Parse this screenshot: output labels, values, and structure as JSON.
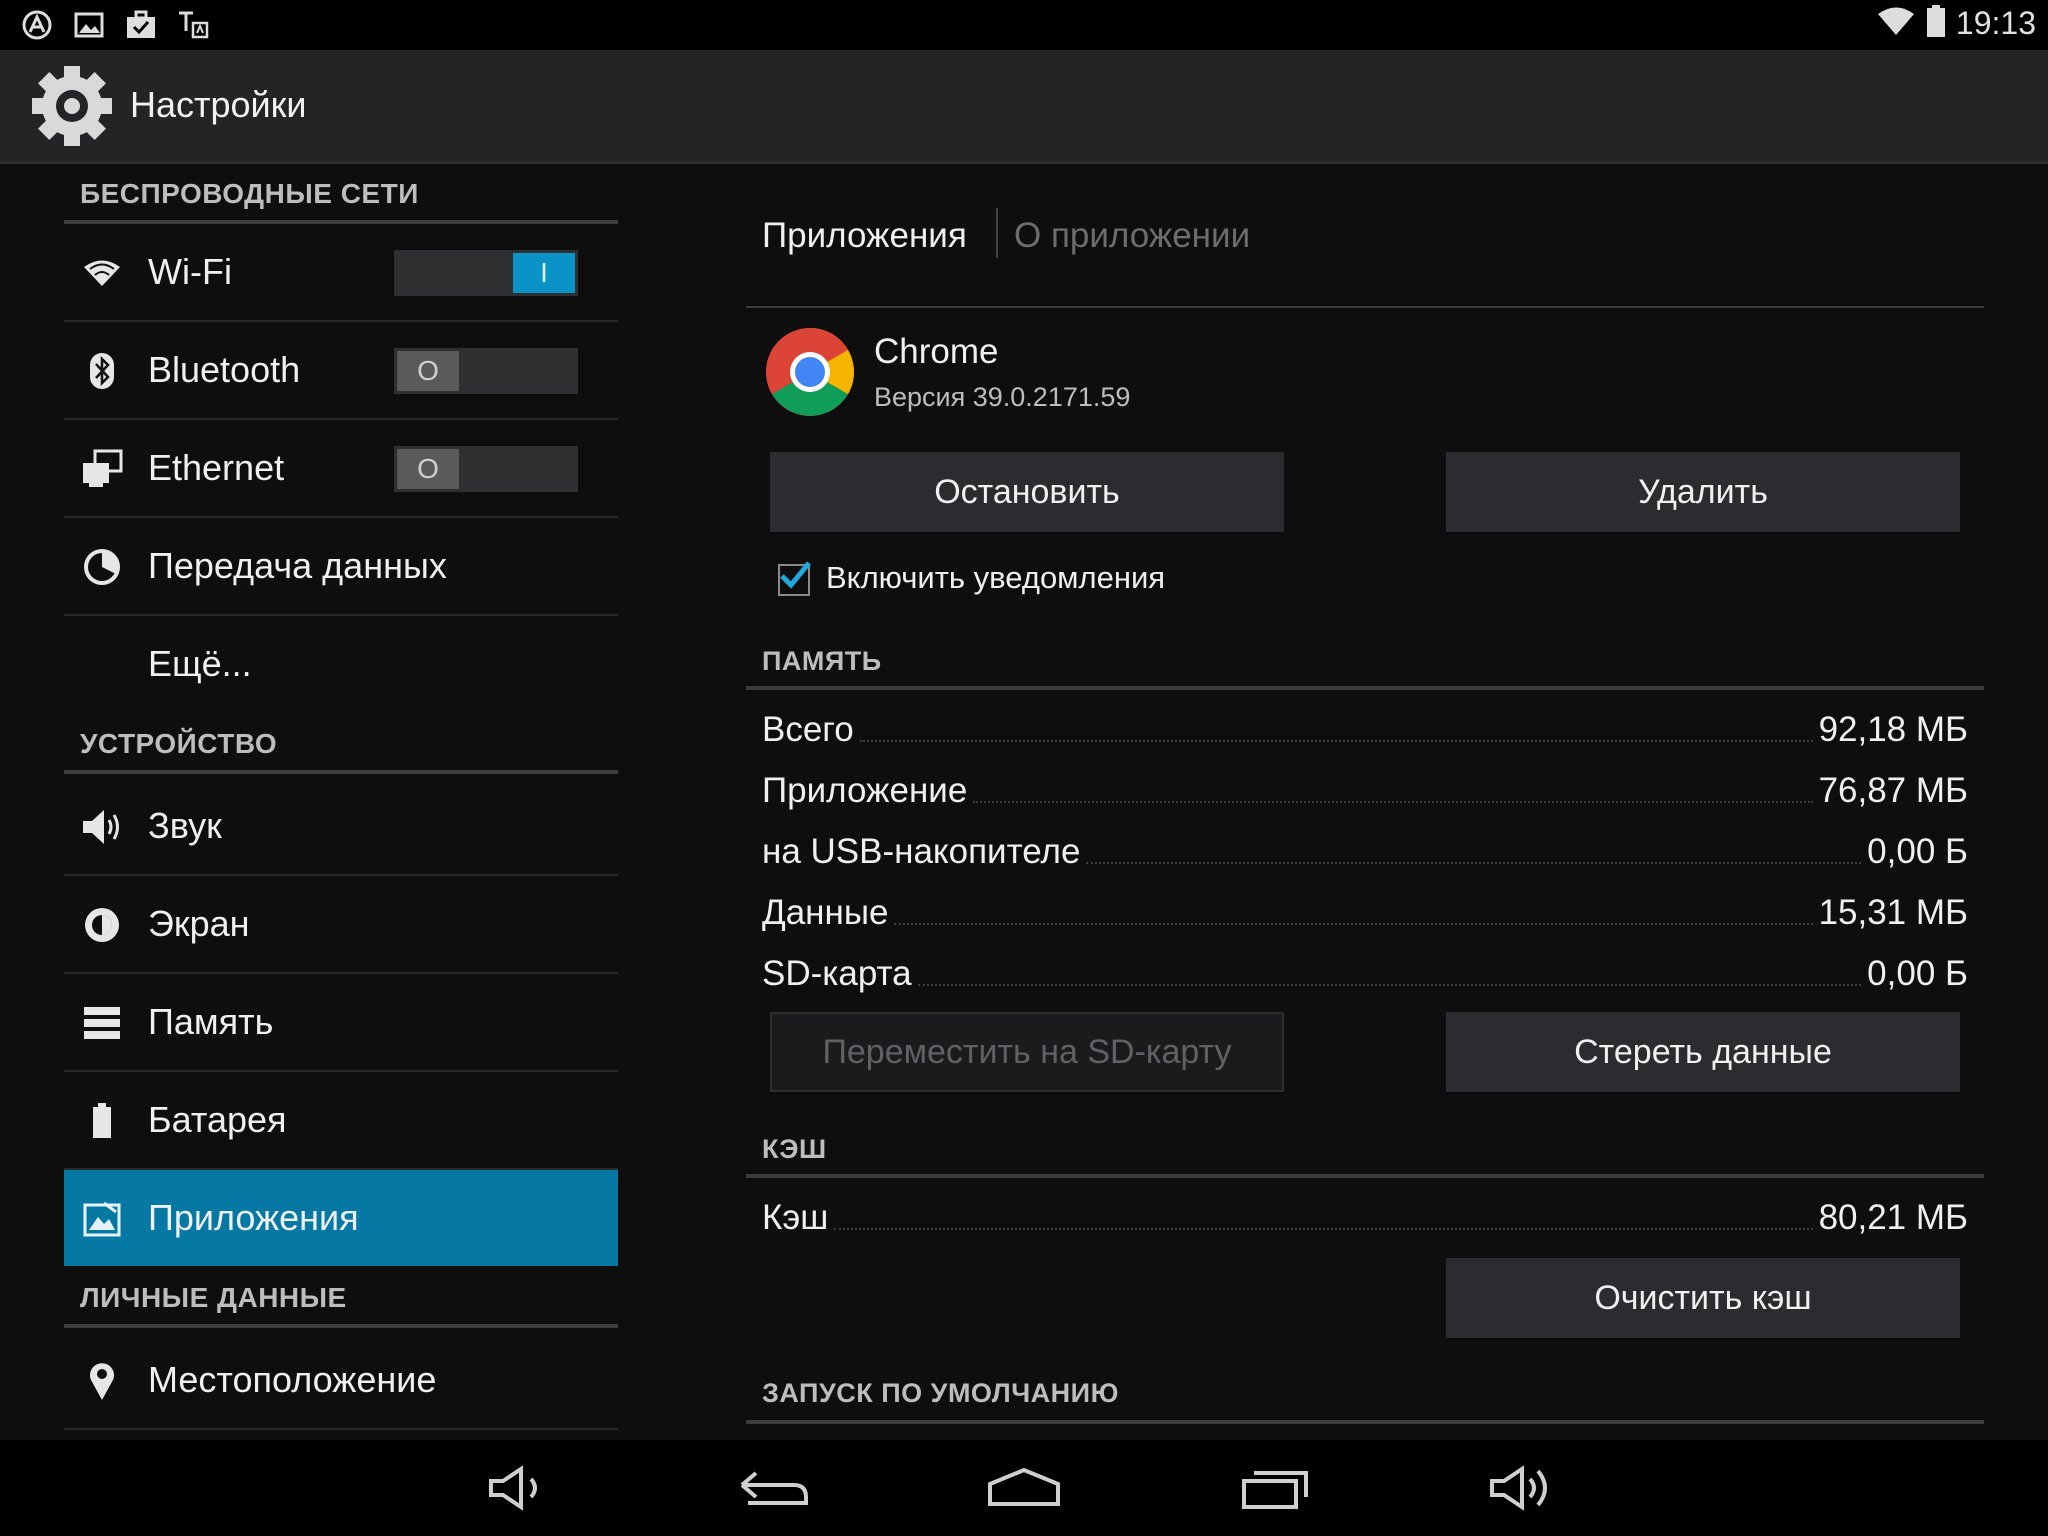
{
  "status": {
    "time": "19:13"
  },
  "app": {
    "title": "Настройки"
  },
  "sidebar": {
    "sections": [
      {
        "header": "БЕСПРОВОДНЫЕ СЕТИ"
      },
      {
        "header": "УСТРОЙСТВО"
      },
      {
        "header": "ЛИЧНЫЕ ДАННЫЕ"
      }
    ],
    "items": [
      {
        "label": "Wi-Fi",
        "icon": "wifi-icon",
        "toggle": "I"
      },
      {
        "label": "Bluetooth",
        "icon": "bluetooth-icon",
        "toggle": "O"
      },
      {
        "label": "Ethernet",
        "icon": "ethernet-icon",
        "toggle": "O"
      },
      {
        "label": "Передача данных",
        "icon": "data-usage-icon"
      },
      {
        "label": "Ещё..."
      },
      {
        "label": "Звук",
        "icon": "volume-icon"
      },
      {
        "label": "Экран",
        "icon": "brightness-icon"
      },
      {
        "label": "Память",
        "icon": "storage-icon"
      },
      {
        "label": "Батарея",
        "icon": "battery-icon"
      },
      {
        "label": "Приложения",
        "icon": "apps-icon",
        "active": true
      },
      {
        "label": "Местоположение",
        "icon": "location-icon"
      }
    ]
  },
  "main": {
    "breadcrumb": [
      "Приложения",
      "О приложении"
    ],
    "app_name": "Chrome",
    "app_version": "Версия 39.0.2171.59",
    "stop_button": "Остановить",
    "uninstall_button": "Удалить",
    "notifications_label": "Включить уведомления",
    "notifications_checked": true,
    "storage": {
      "header": "ПАМЯТЬ",
      "rows": [
        {
          "label": "Всего",
          "value": "92,18 МБ"
        },
        {
          "label": "Приложение",
          "value": "76,87 МБ"
        },
        {
          "label": "на USB-накопителе",
          "value": "0,00 Б"
        },
        {
          "label": "Данные",
          "value": "15,31 МБ"
        },
        {
          "label": "SD-карта",
          "value": "0,00 Б"
        }
      ],
      "move_button": "Переместить на SD-карту",
      "clear_data_button": "Стереть данные"
    },
    "cache": {
      "header": "КЭШ",
      "label": "Кэш",
      "value": "80,21 МБ",
      "clear_cache_button": "Очистить кэш"
    },
    "launch_default_header": "ЗАПУСК ПО УМОЛЧАНИЮ"
  },
  "colors": {
    "accent": "#0579a4",
    "toggle_on": "#0a93c6"
  }
}
